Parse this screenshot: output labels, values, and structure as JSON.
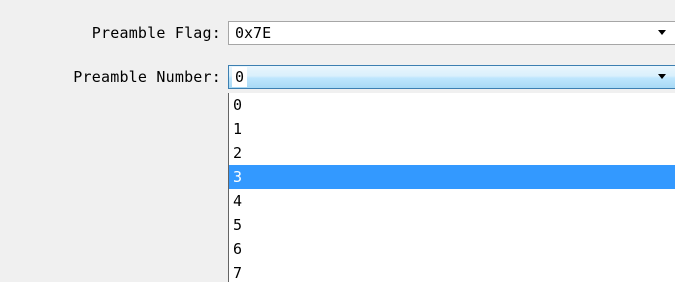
{
  "preamble_flag": {
    "label": "Preamble Flag:",
    "value": "0x7E"
  },
  "preamble_number": {
    "label": "Preamble Number:",
    "value": "0",
    "options": [
      "0",
      "1",
      "2",
      "3",
      "4",
      "5",
      "6",
      "7"
    ],
    "highlighted": "3"
  },
  "colors": {
    "highlight": "#3399ff",
    "focus_border": "#3c7fb1"
  },
  "icons": {
    "dropdown": "chevron-down-icon"
  }
}
